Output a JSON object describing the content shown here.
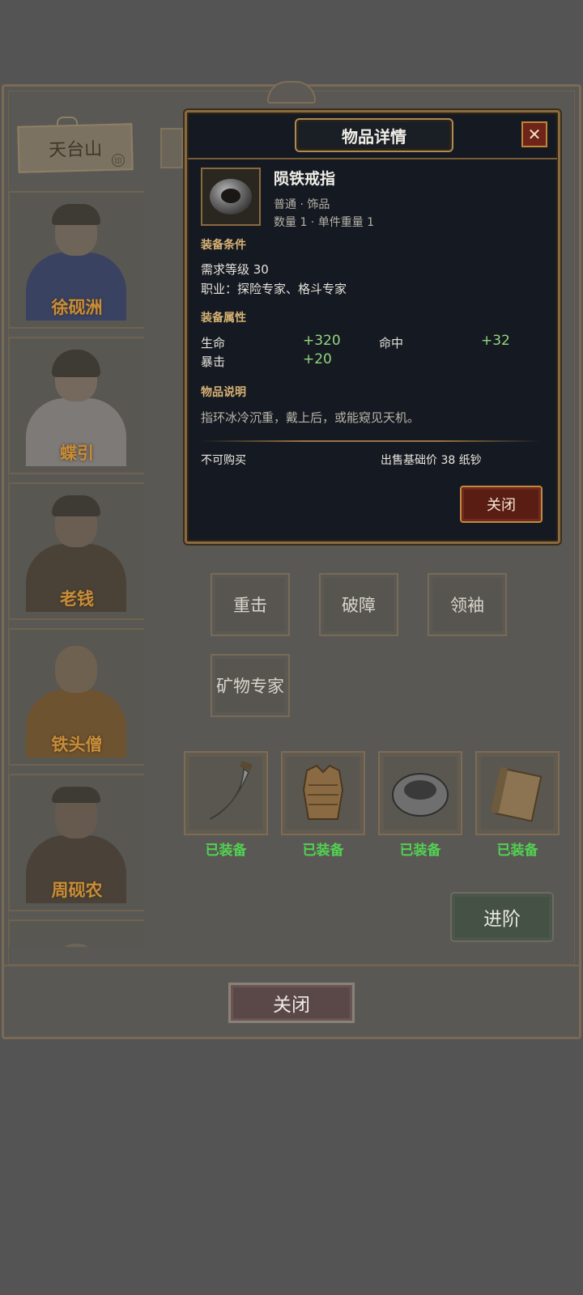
{
  "location": {
    "name": "天台山",
    "seal": "印"
  },
  "characters": [
    {
      "name": "徐砚洲",
      "robe": "#3a4262",
      "skin": "#6e6457"
    },
    {
      "name": "蝶引",
      "robe": "#7d7a78",
      "skin": "#75695e"
    },
    {
      "name": "老钱",
      "robe": "#4a4236",
      "skin": "#6a5e52"
    },
    {
      "name": "铁头僧",
      "robe": "#6e5330",
      "skin": "#6f6150"
    },
    {
      "name": "周砚农",
      "robe": "#4a4238",
      "skin": "#665a4e"
    }
  ],
  "skills": [
    "重击",
    "破障",
    "领袖",
    "矿物专家"
  ],
  "equipment": [
    {
      "icon": "saber-icon",
      "status": "已装备"
    },
    {
      "icon": "armor-icon",
      "status": "已装备"
    },
    {
      "icon": "ring-icon",
      "status": "已装备"
    },
    {
      "icon": "scroll-icon",
      "status": "已装备"
    }
  ],
  "advance_label": "进阶",
  "close_label": "关闭",
  "modal": {
    "title": "物品详情",
    "close_x": "✕",
    "item": {
      "name": "陨铁戒指",
      "type": "普通 · 饰品",
      "quantity_weight": "数量 1 · 单件重量 1",
      "icon": "ring-icon"
    },
    "requirements": {
      "heading": "装备条件",
      "level": "需求等级 30",
      "profession": "职业：探险专家、格斗专家"
    },
    "attributes": {
      "heading": "装备属性",
      "stats": [
        {
          "label": "生命",
          "value": "+320"
        },
        {
          "label": "命中",
          "value": "+32"
        },
        {
          "label": "暴击",
          "value": "+20"
        }
      ]
    },
    "description": {
      "heading": "物品说明",
      "text": "指环冰冷沉重，戴上后，或能窥见天机。"
    },
    "buy_status": "不可购买",
    "sell_price": "出售基础价 38 纸钞",
    "close_button": "关闭"
  },
  "colors": {
    "accent_gold": "#c88d3a",
    "equipped_green": "#52d152",
    "stat_green": "#93d67a",
    "modal_bg": "#151a22",
    "danger_red": "#6e2418"
  }
}
